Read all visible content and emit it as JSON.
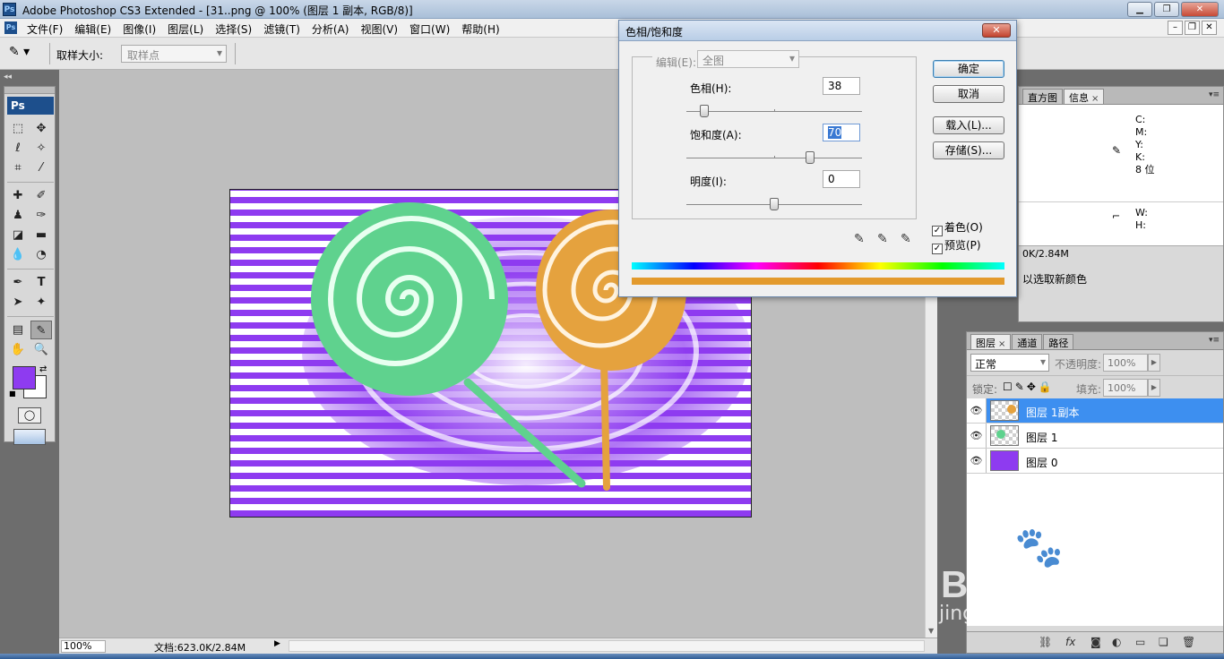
{
  "window": {
    "title": "Adobe Photoshop CS3 Extended - [31..png @ 100% (图层 1 副本, RGB/8)]",
    "app_icon_label": "Ps",
    "minimize_icon": "minimize-icon",
    "restore_icon": "restore-icon",
    "close_icon": "close-icon"
  },
  "menubar": {
    "items": [
      "文件(F)",
      "编辑(E)",
      "图像(I)",
      "图层(L)",
      "选择(S)",
      "滤镜(T)",
      "分析(A)",
      "视图(V)",
      "窗口(W)",
      "帮助(H)"
    ]
  },
  "options": {
    "sample_size_label": "取样大小:",
    "sample_size_value": "取样点"
  },
  "toolbox": {
    "logo": "Ps",
    "foreground_color": "#8e3bf0",
    "background_color": "#ffffff"
  },
  "statusbar": {
    "zoom": "100%",
    "doc_info": "文档:623.0K/2.84M"
  },
  "info_panel": {
    "tabs": [
      "直方图",
      "信息"
    ],
    "active_tab": "信息",
    "cmyk_labels": [
      "C:",
      "M:",
      "Y:",
      "K:"
    ],
    "bit_depth": "8 位",
    "wh_labels": [
      "W:",
      "H:"
    ],
    "doc_size": "0K/2.84M",
    "hint": "以选取新颜色"
  },
  "layers_panel": {
    "tabs": [
      "图层",
      "通道",
      "路径"
    ],
    "active_tab": "图层",
    "blend_mode": "正常",
    "opacity_label": "不透明度:",
    "opacity_value": "100%",
    "lock_label": "锁定:",
    "fill_label": "填充:",
    "fill_value": "100%",
    "layers": [
      {
        "name": "图层 1副本",
        "selected": true
      },
      {
        "name": "图层 1",
        "selected": false
      },
      {
        "name": "图层 0",
        "selected": false
      }
    ]
  },
  "dialog": {
    "title": "色相/饱和度",
    "edit_label": "编辑(E):",
    "edit_value": "全图",
    "hue_label": "色相(H):",
    "hue_value": "38",
    "saturation_label": "饱和度(A):",
    "saturation_value": "70",
    "lightness_label": "明度(I):",
    "lightness_value": "0",
    "ok_label": "确定",
    "cancel_label": "取消",
    "load_label": "载入(L)...",
    "save_label": "存储(S)...",
    "colorize_label": "着色(O)",
    "colorize_checked": true,
    "preview_label": "预览(P)",
    "preview_checked": true,
    "result_color": "#e39a2c"
  },
  "watermark": {
    "brand": "Bai du 经验",
    "url": "jingyan.baidu.com"
  }
}
